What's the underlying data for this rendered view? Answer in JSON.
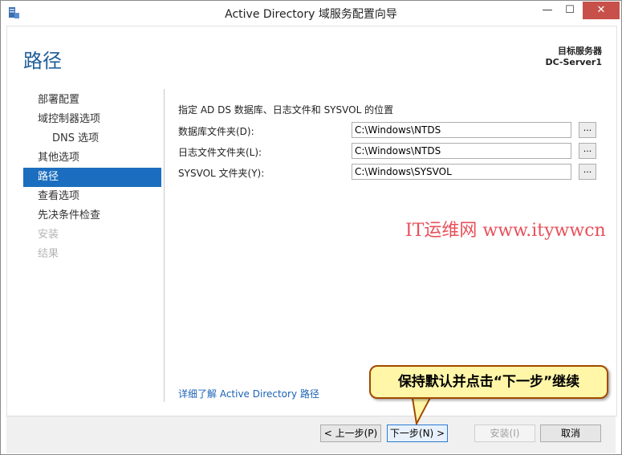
{
  "window": {
    "title": "Active Directory 域服务配置向导",
    "min_label": "—",
    "max_label": "☐",
    "close_label": "✕"
  },
  "header": {
    "page_title": "路径",
    "target_label": "目标服务器",
    "target_name": "DC-Server1"
  },
  "nav": {
    "items": [
      {
        "label": "部署配置",
        "state": "normal"
      },
      {
        "label": "域控制器选项",
        "state": "normal"
      },
      {
        "label": "DNS 选项",
        "state": "sub"
      },
      {
        "label": "其他选项",
        "state": "normal"
      },
      {
        "label": "路径",
        "state": "active"
      },
      {
        "label": "查看选项",
        "state": "normal"
      },
      {
        "label": "先决条件检查",
        "state": "normal"
      },
      {
        "label": "安装",
        "state": "disabled"
      },
      {
        "label": "结果",
        "state": "disabled"
      }
    ]
  },
  "main": {
    "description": "指定 AD DS 数据库、日志文件和 SYSVOL 的位置",
    "fields": [
      {
        "label": "数据库文件夹(D):",
        "value": "C:\\Windows\\NTDS",
        "browse": "..."
      },
      {
        "label": "日志文件文件夹(L):",
        "value": "C:\\Windows\\NTDS",
        "browse": "..."
      },
      {
        "label": "SYSVOL 文件夹(Y):",
        "value": "C:\\Windows\\SYSVOL",
        "browse": "..."
      }
    ],
    "learn_more_link": "详细了解 Active Directory 路径"
  },
  "footer": {
    "back_label": "< 上一步(P)",
    "next_label": "下一步(N) >",
    "install_label": "安装(I)",
    "cancel_label": "取消"
  },
  "annotations": {
    "watermark": "IT运维网 www.itywwcn",
    "callout": "保持默认并点击“下一步”继续"
  },
  "colors": {
    "accent": "#1b6ebf",
    "title_blue": "#1e5d99",
    "close_red": "#c7514a",
    "watermark_red": "#e8505a",
    "callout_fill": "#fff6a8"
  }
}
